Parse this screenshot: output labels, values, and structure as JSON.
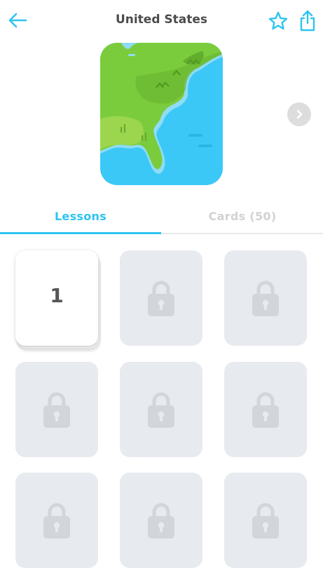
{
  "header": {
    "title": "United States"
  },
  "icons": {
    "back": "arrow-left-icon",
    "favorite": "star-icon",
    "share": "share-icon",
    "next": "chevron-right-icon",
    "lock": "lock-icon"
  },
  "tabs": [
    {
      "label": "Lessons",
      "active": true
    },
    {
      "label": "Cards (50)",
      "active": false
    }
  ],
  "lessons": [
    {
      "label": "1",
      "locked": false
    },
    {
      "label": "",
      "locked": true
    },
    {
      "label": "",
      "locked": true
    },
    {
      "label": "",
      "locked": true
    },
    {
      "label": "",
      "locked": true
    },
    {
      "label": "",
      "locked": true
    },
    {
      "label": "",
      "locked": true
    },
    {
      "label": "",
      "locked": true
    },
    {
      "label": "",
      "locked": true
    }
  ],
  "colors": {
    "accent": "#2fc4f0",
    "title_text": "#4b4b4b",
    "inactive_tab": "#d2d2d2",
    "locked_card": "#e7eaee",
    "lock_icon": "#d2d6da",
    "map_land": "#7acc3c",
    "map_water": "#3cc8f7"
  }
}
